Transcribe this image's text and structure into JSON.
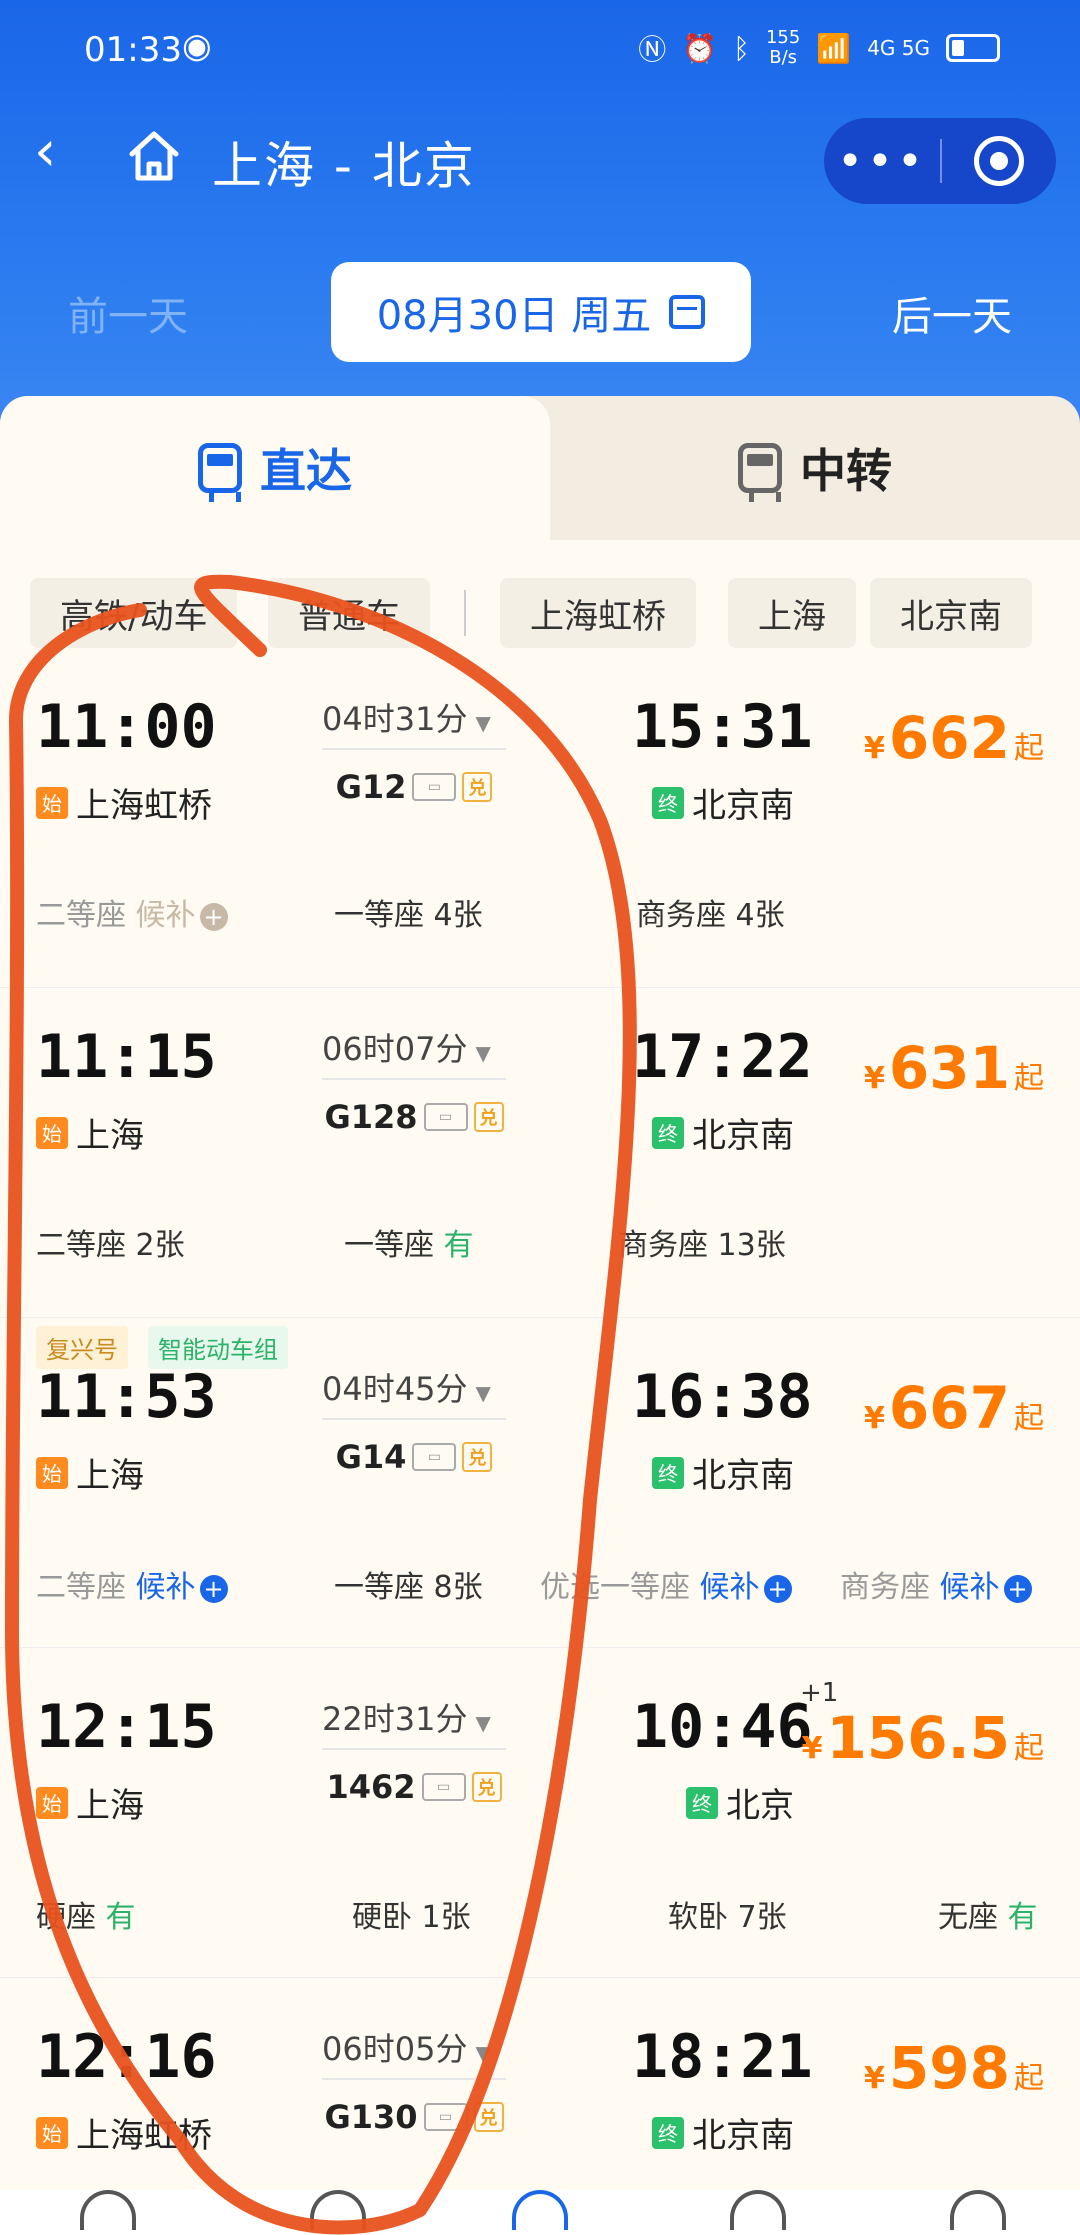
{
  "status": {
    "time": "01:33",
    "net_speed": "155",
    "net_unit": "B/s",
    "net_tags": "4G 5G"
  },
  "nav": {
    "back_icon": "chevron-left-icon",
    "title": "上海 - 北京",
    "more": "•••"
  },
  "dates": {
    "prev": "前一天",
    "current": "08月30日 周五",
    "next": "后一天"
  },
  "tabs": {
    "direct": "直达",
    "transfer": "中转"
  },
  "filters": [
    "高铁/动车",
    "普通车",
    "上海虹桥",
    "上海",
    "北京南"
  ],
  "colors": {
    "brand_blue": "#1a66e8",
    "price_orange": "#ff7a00",
    "ok_green": "#2bb36a",
    "annotation_red": "#e8521c"
  },
  "trains": [
    {
      "dep": "11:00",
      "dep_station": "上海虹桥",
      "duration": "04时31分",
      "number": "G12",
      "arr": "15:31",
      "arr_station": "北京南",
      "price_cur": "¥",
      "price": "662",
      "price_suffix": "起",
      "seats": [
        {
          "name": "二等座",
          "status": "候补"
        },
        {
          "name": "一等座",
          "status": "4张"
        },
        {
          "name": "商务座",
          "status": "4张"
        }
      ]
    },
    {
      "dep": "11:15",
      "dep_station": "上海",
      "duration": "06时07分",
      "number": "G128",
      "arr": "17:22",
      "arr_station": "北京南",
      "price_cur": "¥",
      "price": "631",
      "price_suffix": "起",
      "seats": [
        {
          "name": "二等座",
          "status": "2张"
        },
        {
          "name": "一等座",
          "status": "有"
        },
        {
          "name": "商务座",
          "status": "13张"
        }
      ]
    },
    {
      "tags": [
        "复兴号",
        "智能动车组"
      ],
      "dep": "11:53",
      "dep_station": "上海",
      "duration": "04时45分",
      "number": "G14",
      "arr": "16:38",
      "arr_station": "北京南",
      "price_cur": "¥",
      "price": "667",
      "price_suffix": "起",
      "seats": [
        {
          "name": "二等座",
          "status": "候补"
        },
        {
          "name": "一等座",
          "status": "8张"
        },
        {
          "name": "优选一等座",
          "status": "候补"
        },
        {
          "name": "商务座",
          "status": "候补"
        }
      ]
    },
    {
      "dep": "12:15",
      "dep_station": "上海",
      "duration": "22时31分",
      "number": "1462",
      "arr": "10:46",
      "arr_plus": "+1",
      "arr_station": "北京",
      "price_cur": "¥",
      "price": "156.5",
      "price_suffix": "起",
      "seats": [
        {
          "name": "硬座",
          "status": "有"
        },
        {
          "name": "硬卧",
          "status": "1张"
        },
        {
          "name": "软卧",
          "status": "7张"
        },
        {
          "name": "无座",
          "status": "有"
        }
      ]
    },
    {
      "dep": "12:16",
      "dep_station": "上海虹桥",
      "duration": "06时05分",
      "number": "G130",
      "arr": "18:21",
      "arr_station": "北京南",
      "price_cur": "¥",
      "price": "598",
      "price_suffix": "起"
    }
  ],
  "badges": {
    "start": "始",
    "end": "终",
    "exchange": "兑"
  }
}
